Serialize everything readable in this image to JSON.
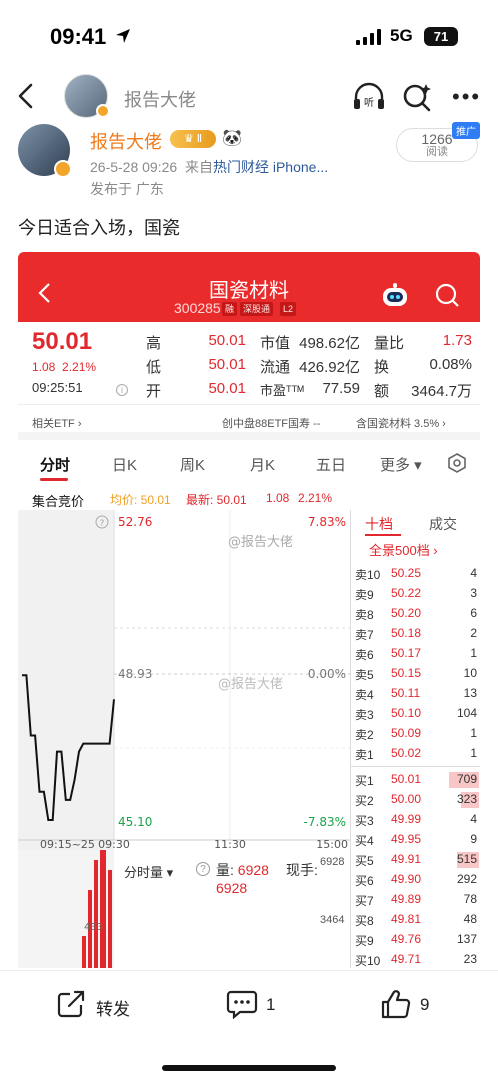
{
  "status": {
    "time": "09:41",
    "network": "5G",
    "battery": "71"
  },
  "nav": {
    "title": "报告大佬",
    "icons": [
      "back-icon",
      "listen-icon",
      "ai-search-icon",
      "more-icon"
    ]
  },
  "post": {
    "author": "报告大佬",
    "vip_level": "Ⅱ",
    "emoji": "🐼",
    "meta_time": "26-5-28 09:26",
    "meta_from": "来自",
    "meta_source": "热门财经 iPhone...",
    "location": "发布于 广东",
    "reads_count": "1266",
    "reads_label": "阅读",
    "reads_tag": "推广",
    "text": "今日适合入场，国瓷"
  },
  "stock": {
    "name": "国瓷材料",
    "code": "300285",
    "tags": [
      "融",
      "深股通",
      "L2"
    ],
    "price": "50.01",
    "change": "1.08",
    "change_pct": "2.21%",
    "time": "09:25:51",
    "high_label": "高",
    "high": "50.01",
    "low_label": "低",
    "low": "50.01",
    "open_label": "开",
    "open": "50.01",
    "mktcap_label": "市值",
    "mktcap": "498.62亿",
    "float_label": "流通",
    "float": "426.92亿",
    "pe_label": "市盈ᵀᵀᴹ",
    "pe": "77.59",
    "vr_label": "量比",
    "vr": "1.73",
    "turnover_label": "换",
    "turnover": "0.08%",
    "amount_label": "额",
    "amount": "3464.7万",
    "etf_label": "相关ETF ›",
    "etf_middle": "创中盘88ETF国寿  --",
    "etf_right": "含国瓷材料  3.5% ›"
  },
  "tabs": [
    "分时",
    "日K",
    "周K",
    "月K",
    "五日",
    "更多 ▾"
  ],
  "auction": {
    "label": "集合竞价",
    "avg": "均价: 50.01",
    "latest": "最新: 50.01",
    "chg": "1.08",
    "pct": "2.21%"
  },
  "chart_data": {
    "type": "line",
    "title": "",
    "x_ticks": [
      "09:15~25",
      "09:30",
      "11:30",
      "15:00"
    ],
    "y_ticks_left": [
      "52.76",
      "48.93",
      "45.10"
    ],
    "y_ticks_right": [
      "7.83%",
      "0.00%",
      "-7.83%"
    ],
    "ylim": [
      45.1,
      52.76
    ],
    "series": [
      {
        "values": [
          48.9,
          48.9,
          47.4,
          47.4,
          46.0,
          46.0,
          45.3,
          45.3,
          47.0,
          47.0,
          45.8,
          45.8,
          46.3,
          47.0,
          47.2,
          47.2,
          47.2,
          47.2,
          47.2,
          47.2,
          47.2,
          48.3
        ]
      }
    ],
    "color": "#111111",
    "watermarks": [
      "@报告大佬",
      "@报告大佬"
    ]
  },
  "orderbook": {
    "tabs": [
      "十档",
      "成交"
    ],
    "full_label": "全景500档 ›",
    "asks": [
      {
        "label": "卖10",
        "price": "50.25",
        "vol": "4"
      },
      {
        "label": "卖9",
        "price": "50.22",
        "vol": "3"
      },
      {
        "label": "卖8",
        "price": "50.20",
        "vol": "6"
      },
      {
        "label": "卖7",
        "price": "50.18",
        "vol": "2"
      },
      {
        "label": "卖6",
        "price": "50.17",
        "vol": "1"
      },
      {
        "label": "卖5",
        "price": "50.15",
        "vol": "10"
      },
      {
        "label": "卖4",
        "price": "50.11",
        "vol": "13"
      },
      {
        "label": "卖3",
        "price": "50.10",
        "vol": "104"
      },
      {
        "label": "卖2",
        "price": "50.09",
        "vol": "1"
      },
      {
        "label": "卖1",
        "price": "50.02",
        "vol": "1"
      }
    ],
    "bids": [
      {
        "label": "买1",
        "price": "50.01",
        "vol": "709",
        "bar": 0.3
      },
      {
        "label": "买2",
        "price": "50.00",
        "vol": "323",
        "bar": 0.18
      },
      {
        "label": "买3",
        "price": "49.99",
        "vol": "4",
        "bar": 0
      },
      {
        "label": "买4",
        "price": "49.95",
        "vol": "9",
        "bar": 0
      },
      {
        "label": "买5",
        "price": "49.91",
        "vol": "515",
        "bar": 0.22
      },
      {
        "label": "买6",
        "price": "49.90",
        "vol": "292",
        "bar": 0
      },
      {
        "label": "买7",
        "price": "49.89",
        "vol": "78",
        "bar": 0
      },
      {
        "label": "买8",
        "price": "49.81",
        "vol": "48",
        "bar": 0
      },
      {
        "label": "买9",
        "price": "49.76",
        "vol": "137",
        "bar": 0
      },
      {
        "label": "买10",
        "price": "49.71",
        "vol": "23",
        "bar": 0
      }
    ]
  },
  "volume": {
    "label": "分时量 ▾",
    "help": "?",
    "qty_label": "量: ",
    "qty": "6928",
    "now_label": "现手:",
    "qty2": "6928",
    "r1": "6928",
    "r2": "3464",
    "mini_tick": "433"
  },
  "actions": {
    "share": "转发",
    "comment": "1",
    "like": "9"
  },
  "colors": {
    "up": "#e0282e",
    "header": "#ea2b2b",
    "accent": "#f07a1a"
  }
}
